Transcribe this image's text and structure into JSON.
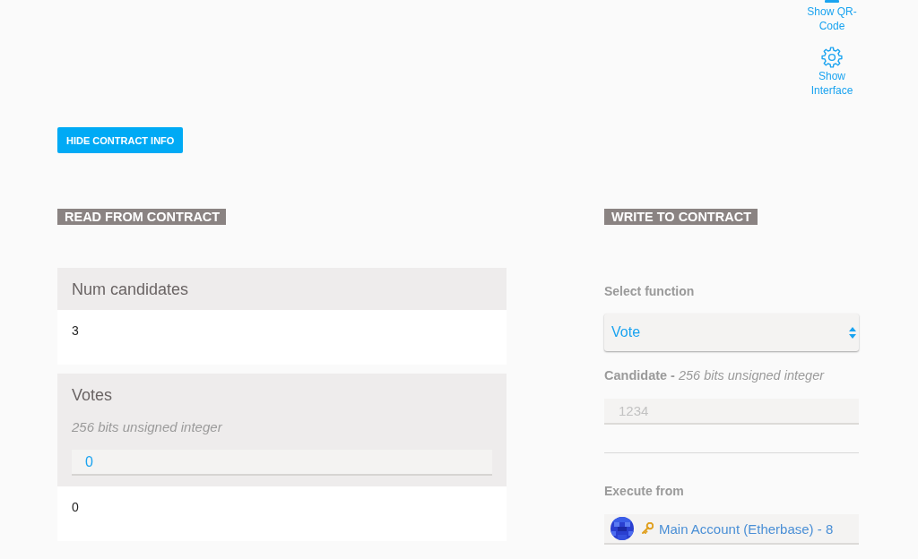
{
  "header_actions": [
    {
      "kind": "qr",
      "label": "Show QR-Code"
    },
    {
      "kind": "gear",
      "label": "Show Interface"
    }
  ],
  "toggle_button": {
    "label": "HIDE CONTRACT INFO"
  },
  "read_section": {
    "title": "READ FROM CONTRACT",
    "items": [
      {
        "kind": "constant",
        "name": "Num candidates",
        "result": "3"
      },
      {
        "kind": "function",
        "name": "Votes",
        "input_type": "256 bits unsigned integer",
        "input_value": "0",
        "result": "0"
      }
    ]
  },
  "write_section": {
    "title": "WRITE TO CONTRACT",
    "function_label": "Select function",
    "function": "Vote",
    "params": [
      {
        "label": "Candidate - *256 bits unsigned integer*",
        "placeholder": "1234"
      }
    ],
    "execute_label": "Execute from",
    "account": "Main Account (Etherbase) - 8"
  }
}
